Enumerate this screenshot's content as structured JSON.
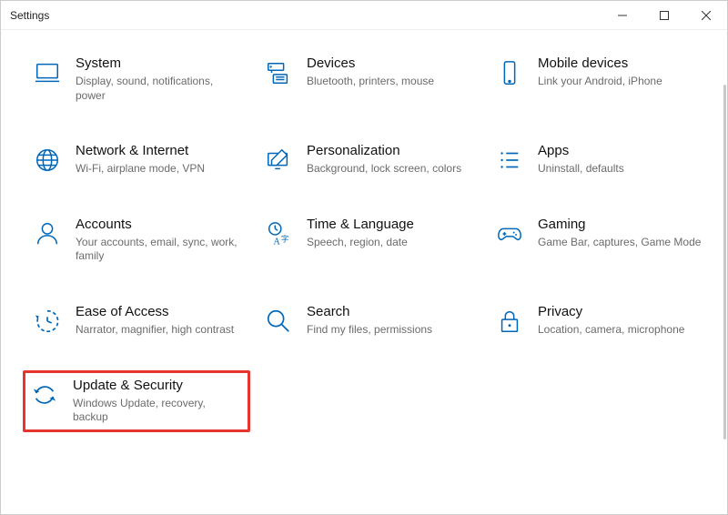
{
  "window": {
    "title": "Settings"
  },
  "categories": [
    {
      "id": "system",
      "title": "System",
      "desc": "Display, sound, notifications, power"
    },
    {
      "id": "devices",
      "title": "Devices",
      "desc": "Bluetooth, printers, mouse"
    },
    {
      "id": "mobile",
      "title": "Mobile devices",
      "desc": "Link your Android, iPhone"
    },
    {
      "id": "network",
      "title": "Network & Internet",
      "desc": "Wi-Fi, airplane mode, VPN"
    },
    {
      "id": "personalization",
      "title": "Personalization",
      "desc": "Background, lock screen, colors"
    },
    {
      "id": "apps",
      "title": "Apps",
      "desc": "Uninstall, defaults"
    },
    {
      "id": "accounts",
      "title": "Accounts",
      "desc": "Your accounts, email, sync, work, family"
    },
    {
      "id": "time",
      "title": "Time & Language",
      "desc": "Speech, region, date"
    },
    {
      "id": "gaming",
      "title": "Gaming",
      "desc": "Game Bar, captures, Game Mode"
    },
    {
      "id": "ease",
      "title": "Ease of Access",
      "desc": "Narrator, magnifier, high contrast"
    },
    {
      "id": "search",
      "title": "Search",
      "desc": "Find my files, permissions"
    },
    {
      "id": "privacy",
      "title": "Privacy",
      "desc": "Location, camera, microphone"
    },
    {
      "id": "update",
      "title": "Update & Security",
      "desc": "Windows Update, recovery, backup",
      "highlight": true
    }
  ],
  "accent": "#0067b8"
}
